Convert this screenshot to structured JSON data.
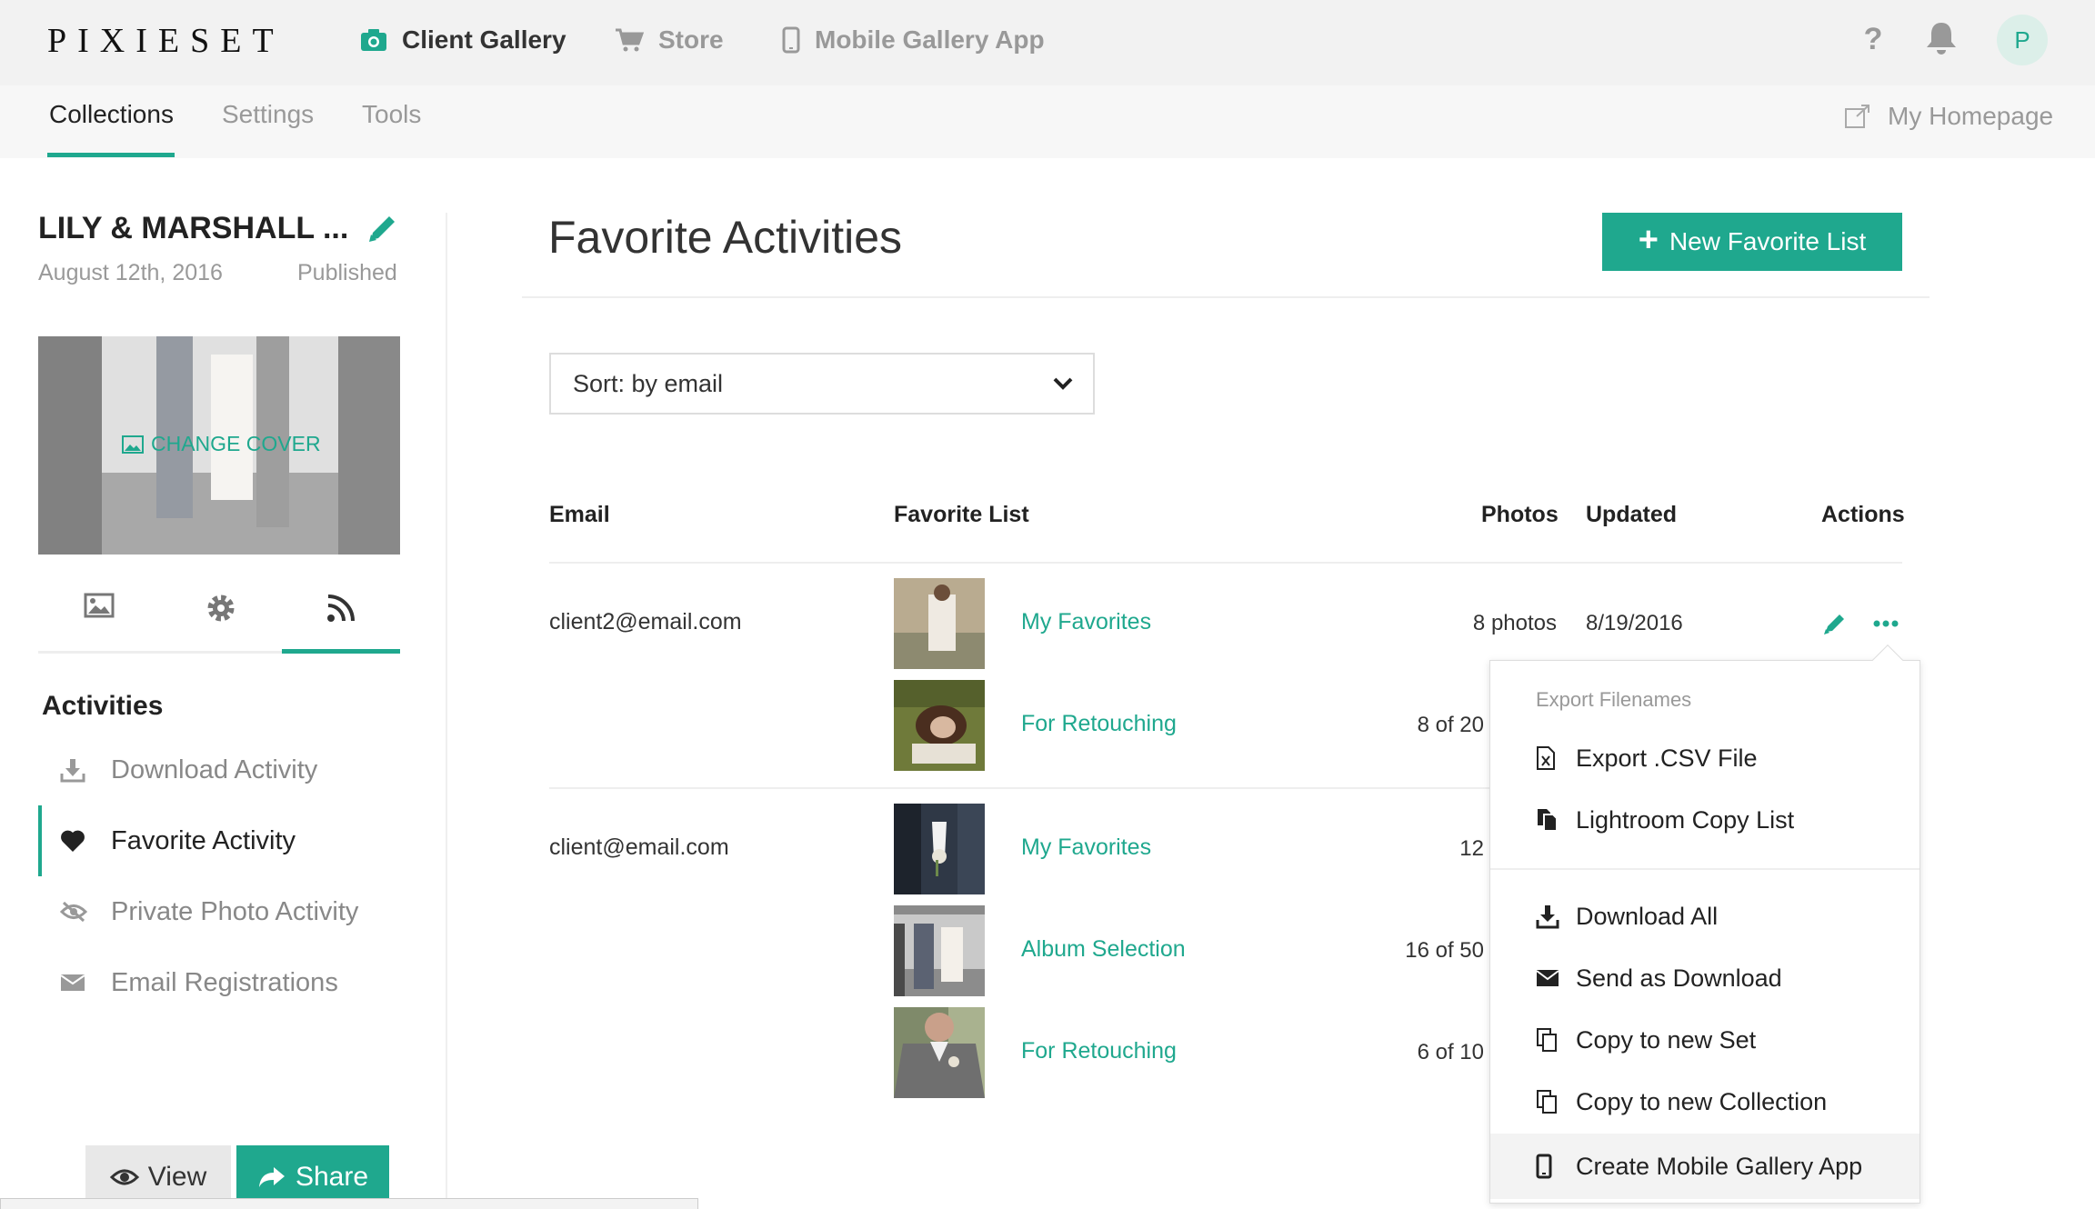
{
  "brand": "PIXIESET",
  "topnav": [
    {
      "label": "Client Gallery",
      "icon": "camera-icon",
      "active": true
    },
    {
      "label": "Store",
      "icon": "cart-icon",
      "active": false
    },
    {
      "label": "Mobile Gallery App",
      "icon": "mobile-icon",
      "active": false
    }
  ],
  "header": {
    "help": "?",
    "avatar_initial": "P"
  },
  "subnav": {
    "tabs": [
      {
        "label": "Collections",
        "active": true
      },
      {
        "label": "Settings",
        "active": false
      },
      {
        "label": "Tools",
        "active": false
      }
    ],
    "my_homepage": "My Homepage"
  },
  "collection": {
    "title": "LILY & MARSHALL ...",
    "date": "August 12th, 2016",
    "status": "Published",
    "change_cover": "CHANGE COVER"
  },
  "sidebar": {
    "tabs": [
      {
        "icon": "image-icon"
      },
      {
        "icon": "gear-icon"
      },
      {
        "icon": "rss-icon",
        "active": true
      }
    ],
    "section_title": "Activities",
    "items": [
      {
        "label": "Download Activity",
        "icon": "download-icon"
      },
      {
        "label": "Favorite Activity",
        "icon": "heart-icon",
        "active": true
      },
      {
        "label": "Private Photo Activity",
        "icon": "eye-slash-icon"
      },
      {
        "label": "Email Registrations",
        "icon": "envelope-icon"
      }
    ],
    "view_label": "View",
    "share_label": "Share"
  },
  "main": {
    "title": "Favorite Activities",
    "new_list_label": "New Favorite List",
    "sort_label": "Sort: by email",
    "columns": {
      "email": "Email",
      "list": "Favorite List",
      "photos": "Photos",
      "updated": "Updated",
      "actions": "Actions"
    },
    "groups": [
      {
        "email": "client2@email.com",
        "lists": [
          {
            "name": "My Favorites",
            "photos": "8 photos",
            "updated": "8/19/2016"
          },
          {
            "name": "For Retouching",
            "photos": "8 of 20",
            "updated": ""
          }
        ]
      },
      {
        "email": "client@email.com",
        "lists": [
          {
            "name": "My Favorites",
            "photos": "12",
            "updated": ""
          },
          {
            "name": "Album Selection",
            "photos": "16 of 50",
            "updated": ""
          },
          {
            "name": "For Retouching",
            "photos": "6 of 10",
            "updated": ""
          }
        ]
      }
    ]
  },
  "menu": {
    "header": "Export Filenames",
    "items": [
      {
        "label": "Export .CSV File",
        "icon": "csv-file-icon"
      },
      {
        "label": "Lightroom Copy List",
        "icon": "copy-list-icon"
      },
      {
        "label": "Download All",
        "icon": "download-icon"
      },
      {
        "label": "Send as Download",
        "icon": "envelope-icon"
      },
      {
        "label": "Copy to new Set",
        "icon": "copy-icon"
      },
      {
        "label": "Copy to new Collection",
        "icon": "copy-icon"
      },
      {
        "label": "Create Mobile Gallery App",
        "icon": "mobile-icon"
      }
    ]
  },
  "colors": {
    "accent": "#1fa88e",
    "topbar": "#f2f2f2",
    "subbar": "#f7f7f7"
  }
}
